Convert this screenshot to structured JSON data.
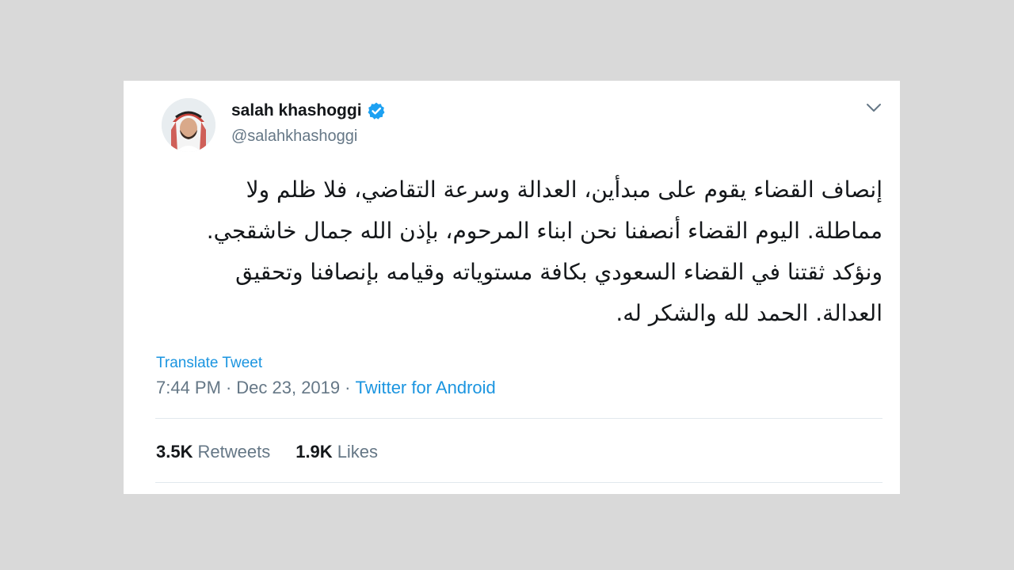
{
  "user": {
    "display_name": "salah khashoggi",
    "handle": "@salahkhashoggi",
    "verified_icon": "verified-badge-icon",
    "verified_color": "#1da1f2"
  },
  "tweet": {
    "lines": [
      "إنصاف القضاء يقوم على مبدأين، العدالة وسرعة التقاضي، فلا ظلم ولا",
      "مماطلة. اليوم القضاء أنصفنا نحن ابناء المرحوم، بإذن الله جمال خاشقجي.",
      "ونؤكد ثقتنا في القضاء السعودي بكافة مستوياته وقيامه بإنصافنا وتحقيق",
      "العدالة. الحمد لله والشكر له."
    ],
    "translate_label": "Translate Tweet",
    "time": "7:44 PM",
    "separator": "·",
    "date": "Dec 23, 2019",
    "source": "Twitter for Android"
  },
  "stats": {
    "retweets_count": "3.5K",
    "retweets_label": "Retweets",
    "likes_count": "1.9K",
    "likes_label": "Likes"
  },
  "colors": {
    "link": "#1b95e0",
    "muted": "#657786",
    "text": "#14171a",
    "background": "#d9d9d9"
  }
}
